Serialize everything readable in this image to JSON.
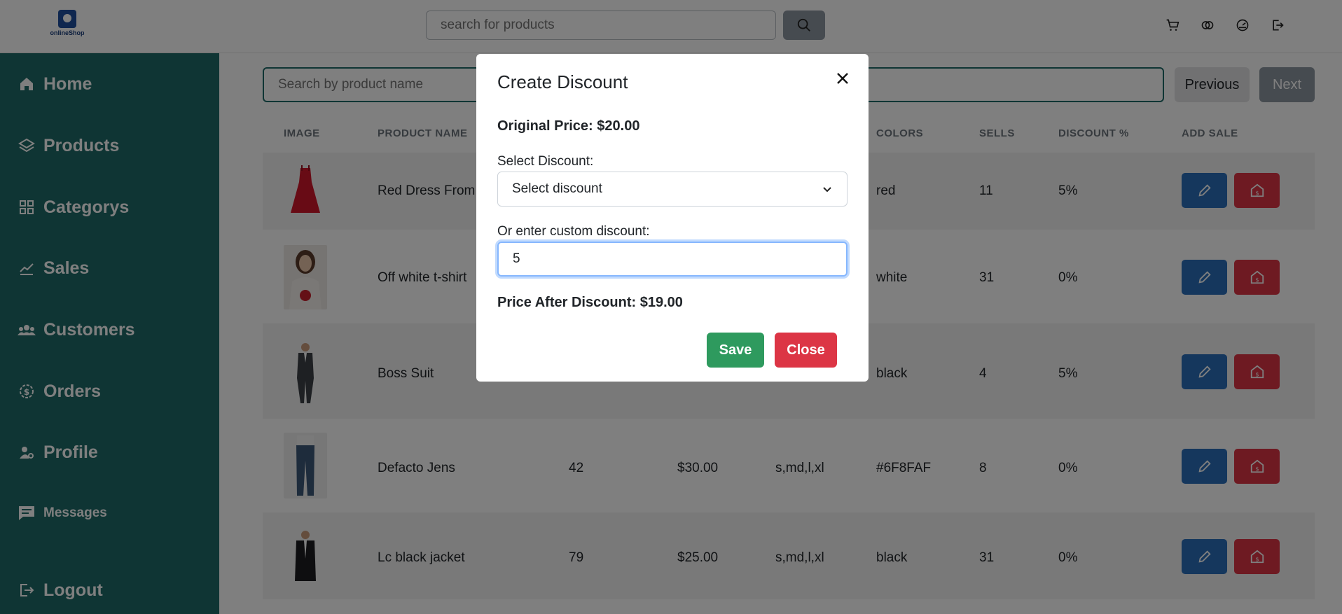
{
  "header": {
    "logo_text": "onlineShop",
    "search_placeholder": "search for products"
  },
  "sidebar": {
    "items": [
      {
        "label": "Home",
        "icon": "home-icon"
      },
      {
        "label": "Products",
        "icon": "layers-icon"
      },
      {
        "label": "Categorys",
        "icon": "grid-icon"
      },
      {
        "label": "Sales",
        "icon": "chart-line-icon"
      },
      {
        "label": "Customers",
        "icon": "users-icon"
      },
      {
        "label": "Orders",
        "icon": "dollar-badge-icon"
      },
      {
        "label": "Profile",
        "icon": "user-gear-icon"
      },
      {
        "label": "Messages",
        "icon": "message-icon"
      },
      {
        "label": "Logout",
        "icon": "logout-icon"
      }
    ]
  },
  "main": {
    "search_placeholder": "Search by product name",
    "previous_label": "Previous",
    "next_label": "Next",
    "columns": [
      "IMAGE",
      "PRODUCT NAME",
      "COLORS",
      "SELLS",
      "DISCOUNT %",
      "ADD SALE"
    ],
    "rows": [
      {
        "name": "Red Dress From",
        "quantity": "",
        "price": "",
        "sizes": "",
        "colors": "red",
        "sells": "11",
        "discount": "5%"
      },
      {
        "name": "Off white t-shirt",
        "quantity": "",
        "price": "",
        "sizes": "",
        "colors": "white",
        "sells": "31",
        "discount": "0%"
      },
      {
        "name": "Boss Suit",
        "quantity": "",
        "price": "",
        "sizes": "",
        "colors": "black",
        "sells": "4",
        "discount": "5%"
      },
      {
        "name": "Defacto Jens",
        "quantity": "42",
        "price": "$30.00",
        "sizes": "s,md,l,xl",
        "colors": "#6F8FAF",
        "sells": "8",
        "discount": "0%"
      },
      {
        "name": "Lc black jacket",
        "quantity": "79",
        "price": "$25.00",
        "sizes": "s,md,l,xl",
        "colors": "black",
        "sells": "31",
        "discount": "0%"
      }
    ]
  },
  "modal": {
    "title": "Create Discount",
    "original_price": "Original Price: $20.00",
    "select_label": "Select Discount:",
    "select_value": "Select discount",
    "custom_label": "Or enter custom discount:",
    "custom_value": "5",
    "after_price": "Price After Discount: $19.00",
    "save_label": "Save",
    "close_label": "Close"
  },
  "colors": {
    "sidebar": "#1f6b68",
    "edit_button": "#2a6fbb",
    "sale_button": "#dc3545",
    "save_button": "#2e9a5e"
  }
}
